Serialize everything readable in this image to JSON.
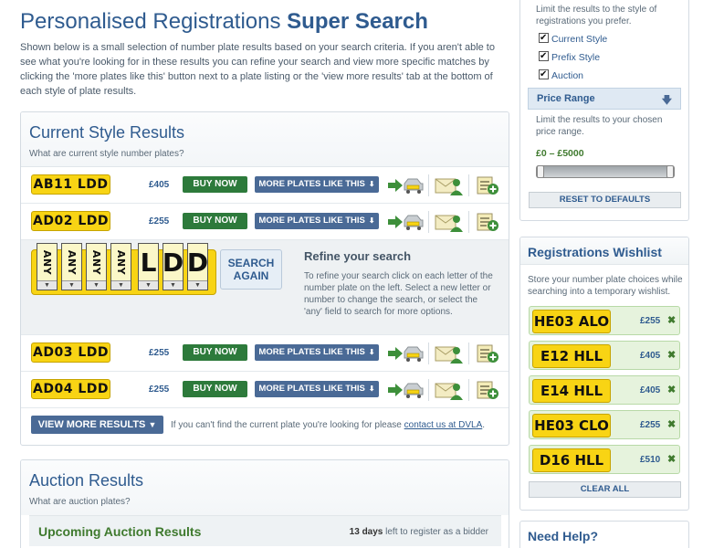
{
  "header": {
    "title_light": "Personalised Registrations ",
    "title_bold": "Super Search",
    "intro": "Shown below is a small selection of number plate results based on your search criteria. If you aren't able to see what you're looking for in these results you can refine your search and view more specific matches by clicking the 'more plates like this' button next to a plate listing or the 'view more results' tab at the bottom of each style of plate results."
  },
  "current_style": {
    "title": "Current Style Results",
    "subtitle": "What are current style number plates?",
    "buy_label": "BUY NOW",
    "more_label": "MORE PLATES LIKE THIS",
    "rows_top": [
      {
        "plate": "AB11 LDD",
        "price": "£405"
      },
      {
        "plate": "AD02 LDD",
        "price": "£255"
      }
    ],
    "rows_bottom": [
      {
        "plate": "AD03 LDD",
        "price": "£255"
      },
      {
        "plate": "AD04 LDD",
        "price": "£255"
      }
    ],
    "refine": {
      "chars": [
        "ANY",
        "ANY",
        "ANY",
        "ANY",
        "L",
        "D",
        "D"
      ],
      "search_again_line1": "SEARCH",
      "search_again_line2": "AGAIN",
      "title": "Refine your search",
      "text": "To refine your search click on each letter of the number plate on the left. Select a new letter or number to change the search, or select the 'any' field to search for more options."
    },
    "view_more_label": "VIEW MORE RESULTS",
    "view_more_note": "If you can't find the current plate you're looking for please ",
    "contact_link": "contact us at DVLA",
    "contact_suffix": "."
  },
  "auction": {
    "title": "Auction Results",
    "subtitle": "What are auction plates?",
    "upcoming_title": "Upcoming Auction Results",
    "days": "13 days",
    "days_suffix": " left to register as a bidder"
  },
  "filters": {
    "style_text": "Limit the results to the style of registrations you prefer.",
    "styles": [
      "Current Style",
      "Prefix Style",
      "Auction"
    ],
    "price_range_label": "Price Range",
    "price_text": "Limit the results to your chosen price range.",
    "price_value": "£0 – £5000",
    "slider_min_fraction": 0,
    "slider_max_fraction": 1,
    "reset_label": "RESET TO DEFAULTS"
  },
  "wishlist": {
    "title": "Registrations Wishlist",
    "text": "Store your number plate choices while searching into a temporary wishlist.",
    "items": [
      {
        "plate": "HE03 ALO",
        "price": "£255"
      },
      {
        "plate": "E12 HLL",
        "price": "£405"
      },
      {
        "plate": "E14 HLL",
        "price": "£405"
      },
      {
        "plate": "HE03 CLO",
        "price": "£255"
      },
      {
        "plate": "D16 HLL",
        "price": "£510"
      }
    ],
    "clear_label": "CLEAR ALL"
  },
  "help": {
    "title": "Need Help?"
  },
  "colors": {
    "brand_blue": "#2f5b8f",
    "buy_green": "#2d7a3b",
    "plate_yellow": "#f8d414",
    "price_green": "#3f7a2e"
  },
  "icons": {
    "reserve": "car-plate-arrow-icon",
    "contact": "envelope-person-icon",
    "wishlist_add": "list-add-icon",
    "remove": "close-icon"
  }
}
